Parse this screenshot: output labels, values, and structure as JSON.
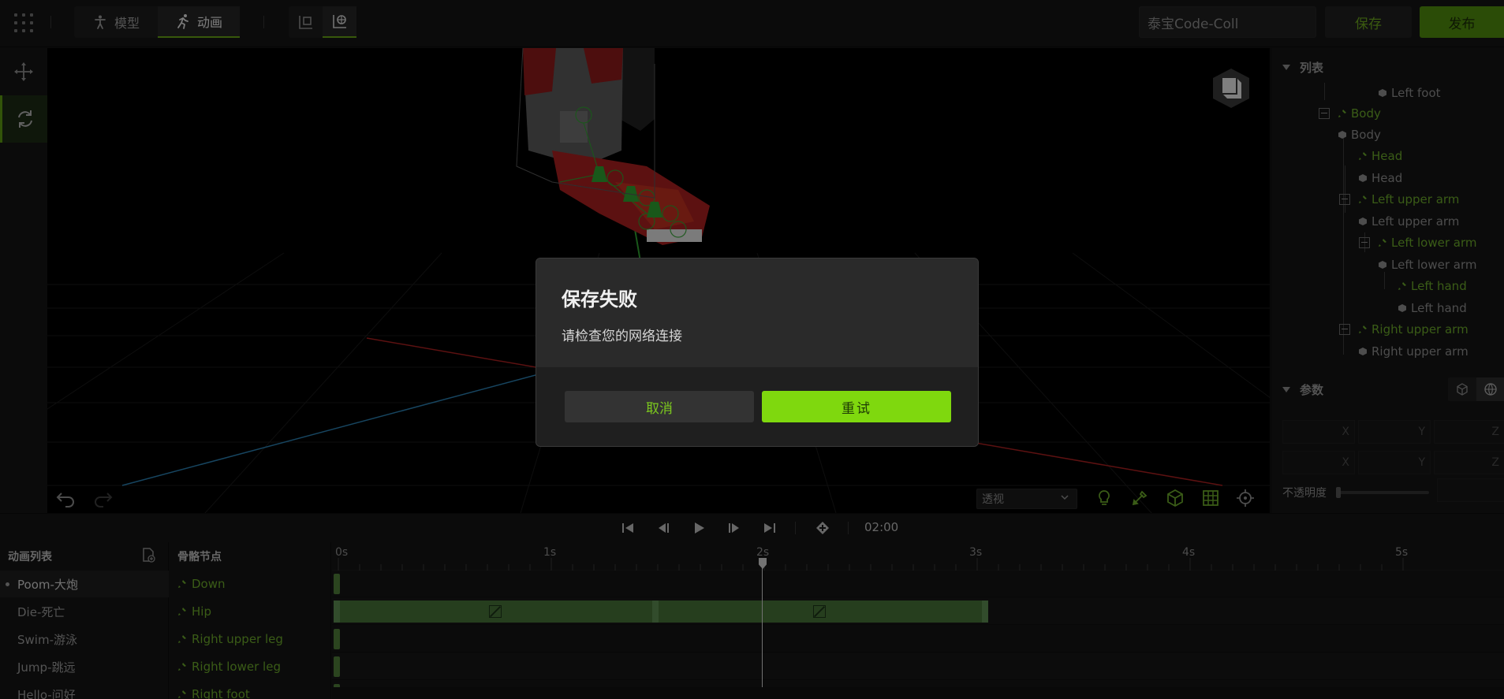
{
  "topbar": {
    "modes": [
      {
        "label": "模型",
        "icon": "person-icon"
      },
      {
        "label": "动画",
        "icon": "running-icon"
      }
    ],
    "project_name": "泰宝Code-Coll",
    "save_label": "保存",
    "publish_label": "发布"
  },
  "viewport": {
    "view_mode": "透视"
  },
  "outline": {
    "title": "列表",
    "items": [
      {
        "label": "Left foot",
        "kind": "mesh"
      },
      {
        "label": "Body",
        "kind": "bone"
      },
      {
        "label": "Body",
        "kind": "mesh"
      },
      {
        "label": "Head",
        "kind": "bone"
      },
      {
        "label": "Head",
        "kind": "mesh"
      },
      {
        "label": "Left upper arm",
        "kind": "bone"
      },
      {
        "label": "Left upper arm",
        "kind": "mesh"
      },
      {
        "label": "Left lower arm",
        "kind": "bone"
      },
      {
        "label": "Left lower arm",
        "kind": "mesh"
      },
      {
        "label": "Left hand",
        "kind": "bone"
      },
      {
        "label": "Left hand",
        "kind": "mesh"
      },
      {
        "label": "Right upper arm",
        "kind": "bone"
      },
      {
        "label": "Right upper arm",
        "kind": "mesh"
      }
    ]
  },
  "params": {
    "title": "参数",
    "axes": [
      "X",
      "Y",
      "Z"
    ],
    "opacity_label": "不透明度"
  },
  "playback": {
    "timecode": "02:00"
  },
  "anim_list": {
    "title": "动画列表",
    "items": [
      "Poom-大炮",
      "Die-死亡",
      "Swim-游泳",
      "Jump-跳远",
      "Hello-问好"
    ]
  },
  "bone_list": {
    "title": "骨骼节点",
    "items": [
      "Down",
      "Hip",
      "Right upper leg",
      "Right lower leg",
      "Right foot"
    ]
  },
  "timeline": {
    "ticks": [
      "0s",
      "1s",
      "2s",
      "3s",
      "4s",
      "5s"
    ],
    "playhead_seconds": 2
  },
  "dialog": {
    "title": "保存失败",
    "message": "请检查您的网络连接",
    "cancel_label": "取消",
    "retry_label": "重试"
  },
  "colors": {
    "accent": "#7fd80e",
    "bone_green": "#6ba82a"
  }
}
